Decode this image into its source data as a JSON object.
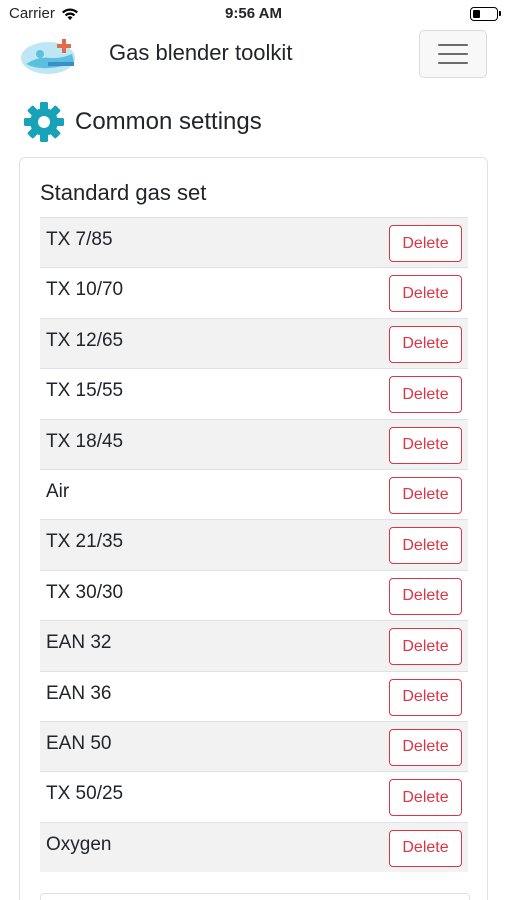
{
  "status_bar": {
    "carrier": "Carrier",
    "time": "9:56 AM",
    "battery_level": 0.25
  },
  "navbar": {
    "brand_title": "Gas blender toolkit",
    "logo_icon": "diver-with-plus-icon",
    "menu_icon": "hamburger-menu-icon"
  },
  "page": {
    "section_icon": "gear-icon",
    "section_title": "Common settings"
  },
  "gas_set": {
    "title": "Standard gas set",
    "delete_label": "Delete",
    "items": [
      {
        "name": "TX 7/85"
      },
      {
        "name": "TX 10/70"
      },
      {
        "name": "TX 12/65"
      },
      {
        "name": "TX 15/55"
      },
      {
        "name": "TX 18/45"
      },
      {
        "name": "Air"
      },
      {
        "name": "TX 21/35"
      },
      {
        "name": "TX 30/30"
      },
      {
        "name": "EAN 32"
      },
      {
        "name": "EAN 36"
      },
      {
        "name": "EAN 50"
      },
      {
        "name": "TX 50/25"
      },
      {
        "name": "Oxygen"
      }
    ]
  },
  "colors": {
    "accent_teal": "#17a2b8",
    "danger": "#dc3545",
    "stripe": "#f2f2f2"
  }
}
